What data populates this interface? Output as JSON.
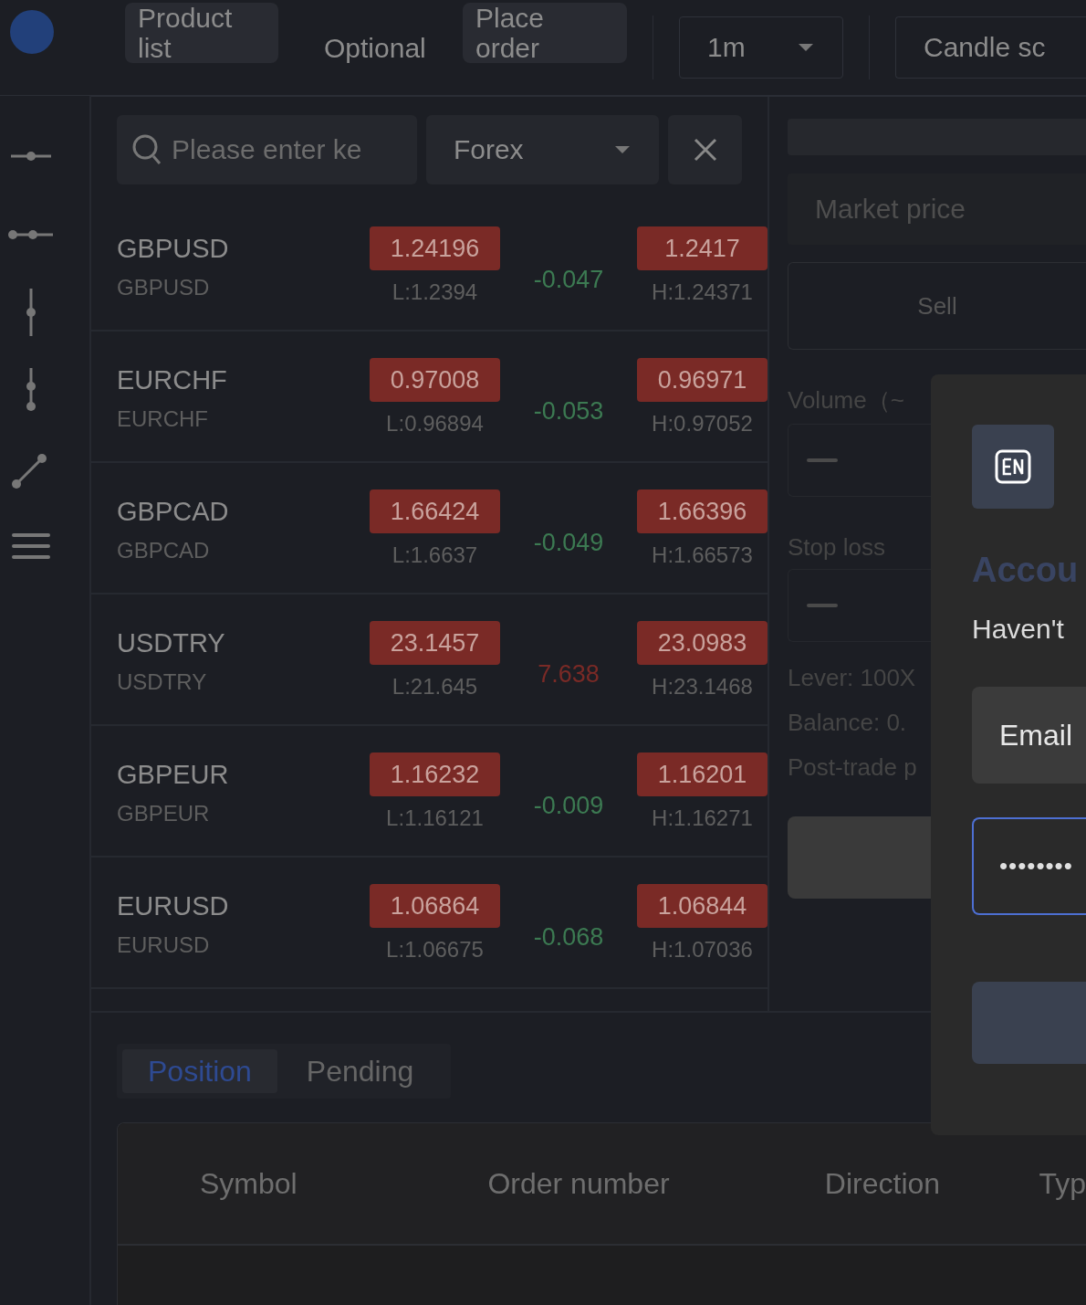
{
  "top_nav": {
    "tabs": [
      {
        "label": "Product list",
        "highlighted": true
      },
      {
        "label": "Optional",
        "highlighted": false
      },
      {
        "label": "Place order",
        "highlighted": true
      }
    ],
    "interval": "1m",
    "chart_type": "Candle sc"
  },
  "toolbar": {
    "tools": [
      {
        "kind": "hline"
      },
      {
        "kind": "ray"
      },
      {
        "kind": "vline"
      },
      {
        "kind": "vray"
      },
      {
        "kind": "segment"
      },
      {
        "kind": "menu"
      }
    ]
  },
  "search": {
    "placeholder": "Please enter ke",
    "category": "Forex"
  },
  "products": [
    {
      "name": "GBPUSD",
      "code": "GBPUSD",
      "bid": "1.24196",
      "low": "L:1.2394",
      "change": "-0.047",
      "color": "#3c7a52",
      "ask": "1.2417",
      "high": "H:1.24371"
    },
    {
      "name": "EURCHF",
      "code": "EURCHF",
      "bid": "0.97008",
      "low": "L:0.96894",
      "change": "-0.053",
      "color": "#3c7a52",
      "ask": "0.96971",
      "high": "H:0.97052"
    },
    {
      "name": "GBPCAD",
      "code": "GBPCAD",
      "bid": "1.66424",
      "low": "L:1.6637",
      "change": "-0.049",
      "color": "#3c7a52",
      "ask": "1.66396",
      "high": "H:1.66573"
    },
    {
      "name": "USDTRY",
      "code": "USDTRY",
      "bid": "23.1457",
      "low": "L:21.645",
      "change": "7.638",
      "color": "#7a2a26",
      "ask": "23.0983",
      "high": "H:23.1468"
    },
    {
      "name": "GBPEUR",
      "code": "GBPEUR",
      "bid": "1.16232",
      "low": "L:1.16121",
      "change": "-0.009",
      "color": "#3c7a52",
      "ask": "1.16201",
      "high": "H:1.16271"
    },
    {
      "name": "EURUSD",
      "code": "EURUSD",
      "bid": "1.06864",
      "low": "L:1.06675",
      "change": "-0.068",
      "color": "#3c7a52",
      "ask": "1.06844",
      "high": "H:1.07036"
    }
  ],
  "order": {
    "price_type": "Market price",
    "side": "Sell",
    "volume_label": "Volume（~",
    "stop_loss_label": "Stop loss",
    "lever": "Lever:  100X",
    "balance": "Balance:  0.",
    "post_trade": "Post-trade p"
  },
  "login": {
    "title": "Accou",
    "subtitle": "Haven't",
    "tabs": [
      {
        "label": "Email",
        "selected": true
      }
    ],
    "password": "••••••••"
  },
  "positions": {
    "tabs": [
      {
        "label": "Position",
        "selected": true
      },
      {
        "label": "Pending",
        "selected": false
      }
    ],
    "columns": [
      "Symbol",
      "Order number",
      "Direction",
      "Typ"
    ]
  }
}
